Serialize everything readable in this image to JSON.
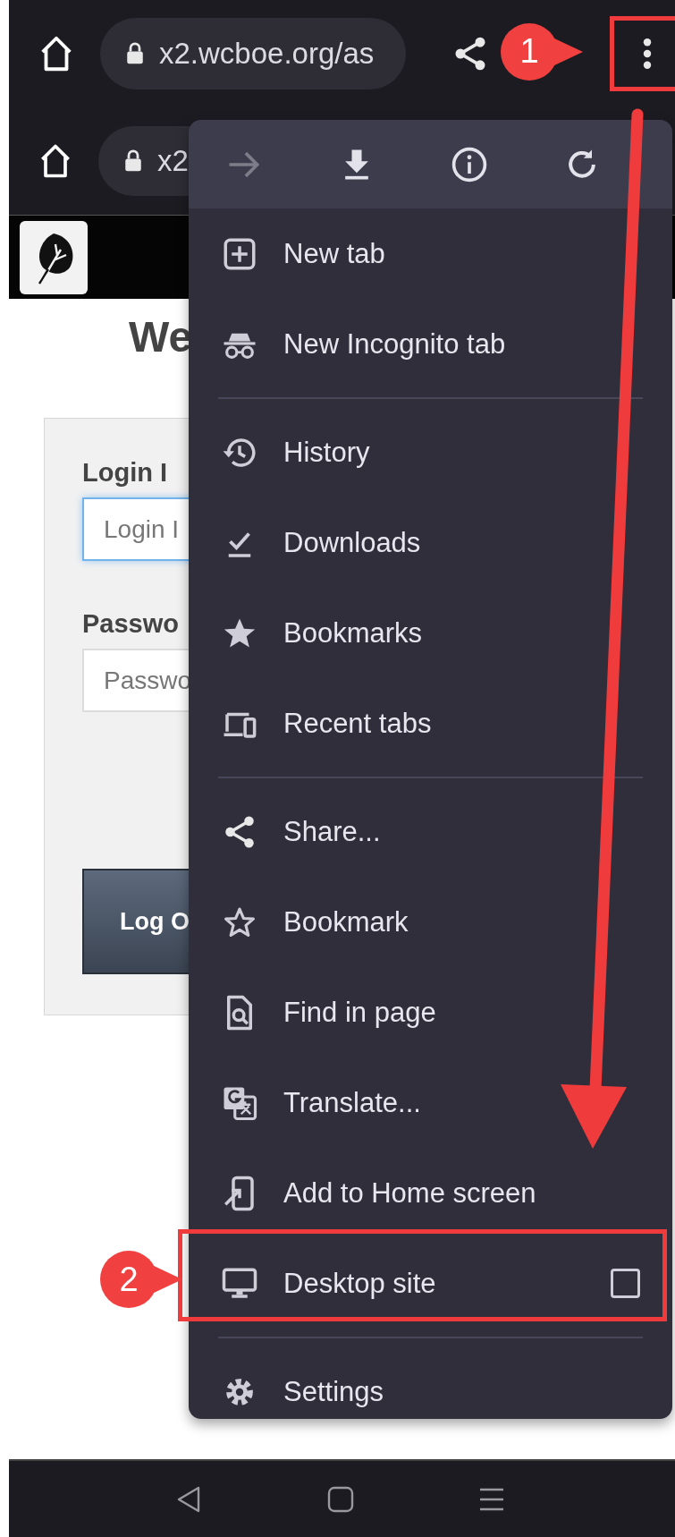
{
  "toolbars": [
    {
      "url": "x2.wcboe.org/as"
    },
    {
      "url": "x2"
    }
  ],
  "page": {
    "heading": "We",
    "login_label": "Login I",
    "login_placeholder": "Login I",
    "password_label": "Passwo",
    "password_placeholder": "Passwo",
    "button": "Log O"
  },
  "menu": {
    "actions": [
      {
        "disabled": true
      },
      {
        "disabled": false
      },
      {
        "disabled": false
      },
      {
        "disabled": false
      }
    ],
    "items": [
      {
        "kind": "item",
        "label": "New tab"
      },
      {
        "kind": "item",
        "label": "New Incognito tab"
      },
      {
        "kind": "divider"
      },
      {
        "kind": "item",
        "label": "History"
      },
      {
        "kind": "item",
        "label": "Downloads"
      },
      {
        "kind": "item",
        "label": "Bookmarks"
      },
      {
        "kind": "item",
        "label": "Recent tabs"
      },
      {
        "kind": "divider"
      },
      {
        "kind": "item",
        "label": "Share..."
      },
      {
        "kind": "item",
        "label": "Bookmark"
      },
      {
        "kind": "item",
        "label": "Find in page"
      },
      {
        "kind": "item",
        "label": "Translate..."
      },
      {
        "kind": "item",
        "label": "Add to Home screen"
      },
      {
        "kind": "check",
        "label": "Desktop site",
        "checked": false
      },
      {
        "kind": "divider"
      },
      {
        "kind": "item",
        "label": "Settings"
      }
    ]
  },
  "annotations": [
    {
      "label": "1"
    },
    {
      "label": "2"
    }
  ]
}
